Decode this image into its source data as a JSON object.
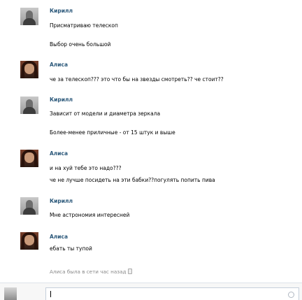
{
  "messages": [
    {
      "author": "Кирилл",
      "lines": [
        "Присматриваю телескоп",
        "Выбор очень большой"
      ]
    },
    {
      "author": "Алиса",
      "lines": [
        "че за телескоп??? это что бы на звезды смотреть?? че стоит??"
      ]
    },
    {
      "author": "Кирилл",
      "lines": [
        "Зависит от модели и диаметра зеркала",
        "Более-менее приличные - от 15 штук и выше"
      ]
    },
    {
      "author": "Алиса",
      "lines": [
        "и на хуй тебе это надо???",
        "че не лучше посидеть на эти бабки??погулять попить пива"
      ]
    },
    {
      "author": "Кирилл",
      "lines": [
        "Мне астрономия интересней"
      ]
    },
    {
      "author": "Алиса",
      "lines": [
        "ебать ты тупой"
      ]
    }
  ],
  "status_text": "Алиса была в сети час назад",
  "icons": {
    "status": "lock-icon",
    "composer_emoji": "smile-icon"
  },
  "colors": {
    "author_name": "#2b587a",
    "status_text": "#888888"
  }
}
